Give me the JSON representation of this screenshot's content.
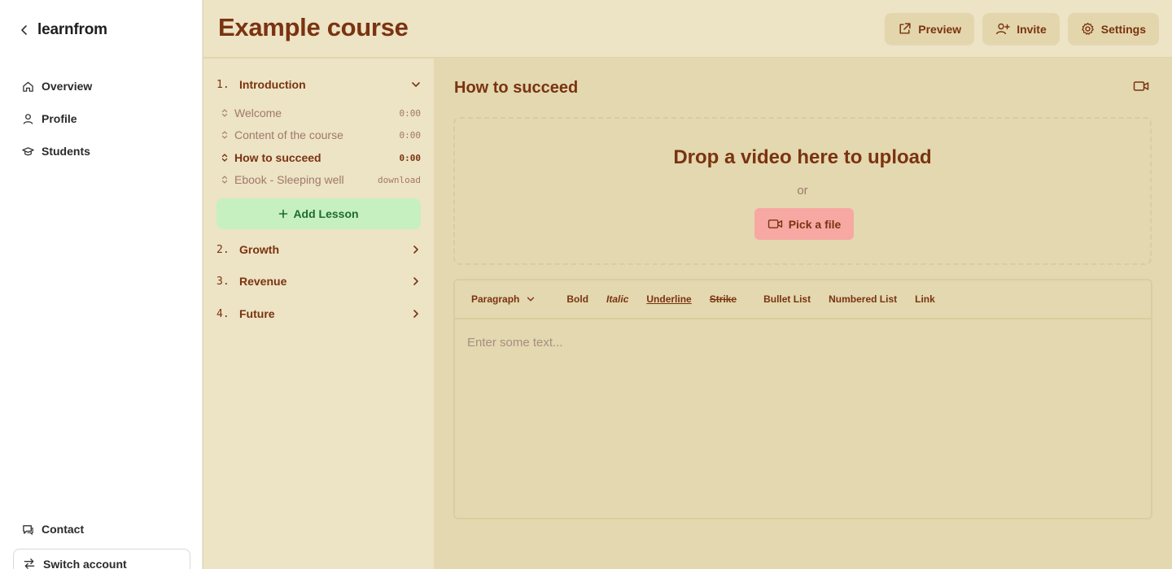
{
  "sidebar": {
    "brand": "learnfrom",
    "nav": [
      {
        "label": "Overview",
        "icon": "home-icon"
      },
      {
        "label": "Profile",
        "icon": "user-icon"
      },
      {
        "label": "Students",
        "icon": "graduation-cap-icon"
      }
    ],
    "bottom": {
      "contact": "Contact",
      "switch_account": "Switch account"
    }
  },
  "header": {
    "title": "Example course",
    "actions": {
      "preview": "Preview",
      "invite": "Invite",
      "settings": "Settings"
    }
  },
  "lessons_panel": {
    "sections": [
      {
        "number": "1.",
        "title": "Introduction",
        "expanded": true
      },
      {
        "number": "2.",
        "title": "Growth",
        "expanded": false
      },
      {
        "number": "3.",
        "title": "Revenue",
        "expanded": false
      },
      {
        "number": "4.",
        "title": "Future",
        "expanded": false
      }
    ],
    "lessons": [
      {
        "title": "Welcome",
        "meta": "0:00",
        "active": false
      },
      {
        "title": "Content of the course",
        "meta": "0:00",
        "active": false
      },
      {
        "title": "How to succeed",
        "meta": "0:00",
        "active": true
      },
      {
        "title": "Ebook - Sleeping well",
        "meta": "download",
        "active": false
      }
    ],
    "add_lesson": "Add Lesson"
  },
  "main": {
    "lesson_title": "How to succeed",
    "upload": {
      "title": "Drop a video here to upload",
      "or": "or",
      "pick_file": "Pick a file"
    },
    "editor": {
      "toolbar": {
        "paragraph": "Paragraph",
        "bold": "Bold",
        "italic": "Italic",
        "underline": "Underline",
        "strike": "Strike",
        "bullet_list": "Bullet List",
        "numbered_list": "Numbered List",
        "link": "Link"
      },
      "placeholder": "Enter some text..."
    }
  },
  "colors": {
    "accent_text": "#7a3310",
    "header_bg": "#ede3c5",
    "main_bg": "#e3d8b0",
    "add_lesson_bg": "#c6f0c0",
    "pick_file_bg": "#f7a8a2"
  }
}
